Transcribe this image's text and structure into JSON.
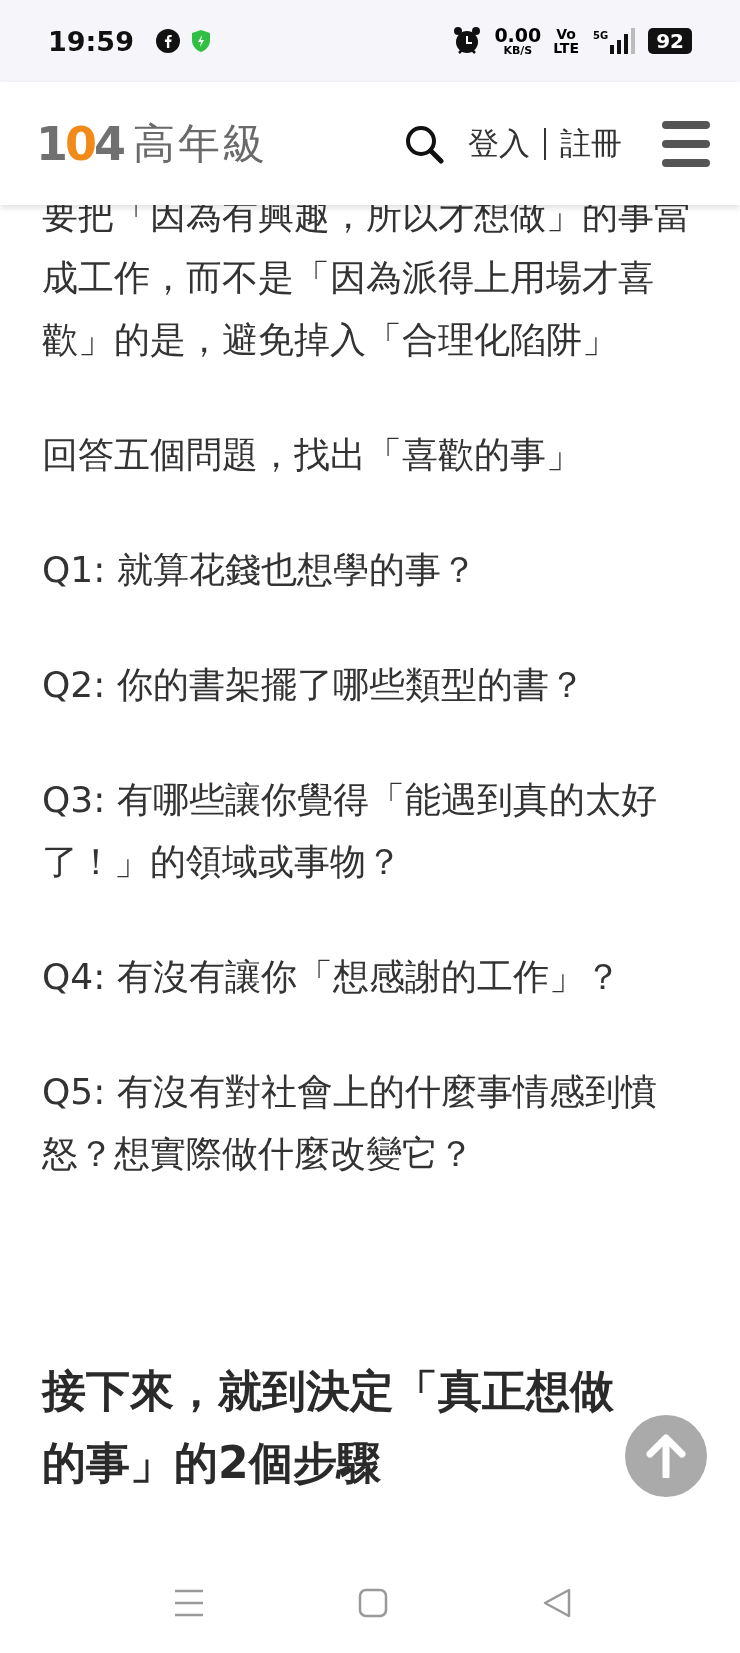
{
  "status_bar": {
    "time": "19:59",
    "network_speed": "0.00",
    "network_speed_unit": "KB/S",
    "volte_top": "Vo",
    "volte_bottom": "LTE",
    "network_type": "5G",
    "battery": "92"
  },
  "header": {
    "logo_number": "104",
    "logo_text": "高年級",
    "login": "登入",
    "register": "註冊"
  },
  "article": {
    "paragraphs": [
      "要把「因為有興趣，所以才想做」的事當成工作，而不是「因為派得上用場才喜歡」的是，避免掉入「合理化陷阱」",
      "回答五個問題，找出「喜歡的事」",
      "Q1: 就算花錢也想學的事？",
      "Q2: 你的書架擺了哪些類型的書？",
      "Q3: 有哪些讓你覺得「能遇到真的太好了！」的領域或事物？",
      "Q4: 有沒有讓你「想感謝的工作」？",
      "Q5: 有沒有對社會上的什麼事情感到憤怒？想實際做什麼改變它？"
    ],
    "heading": "接下來，就到決定「真正想做的事」的2個步驟"
  }
}
